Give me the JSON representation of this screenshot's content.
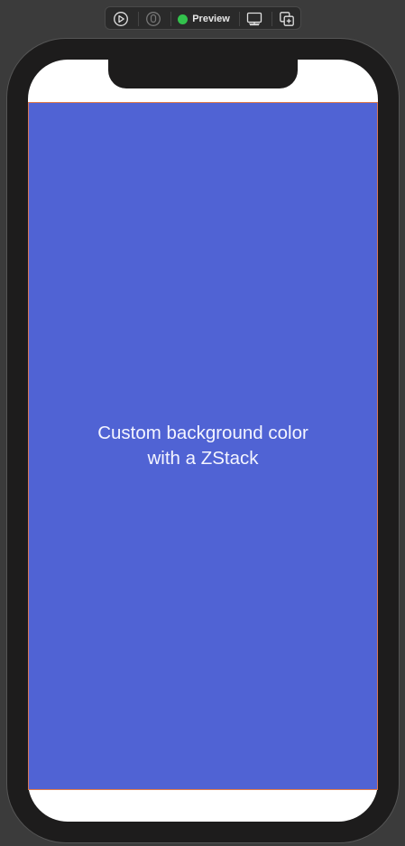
{
  "toolbar": {
    "live_label": "live-preview",
    "selectable_label": "selectable",
    "preview_label": "Preview",
    "preview_status_color": "#33c24d",
    "device_settings_label": "device-settings",
    "duplicate_label": "duplicate-preview"
  },
  "screen": {
    "background_color": "#5063d4",
    "text_line1": "Custom background color",
    "text_line2": "with a ZStack"
  }
}
